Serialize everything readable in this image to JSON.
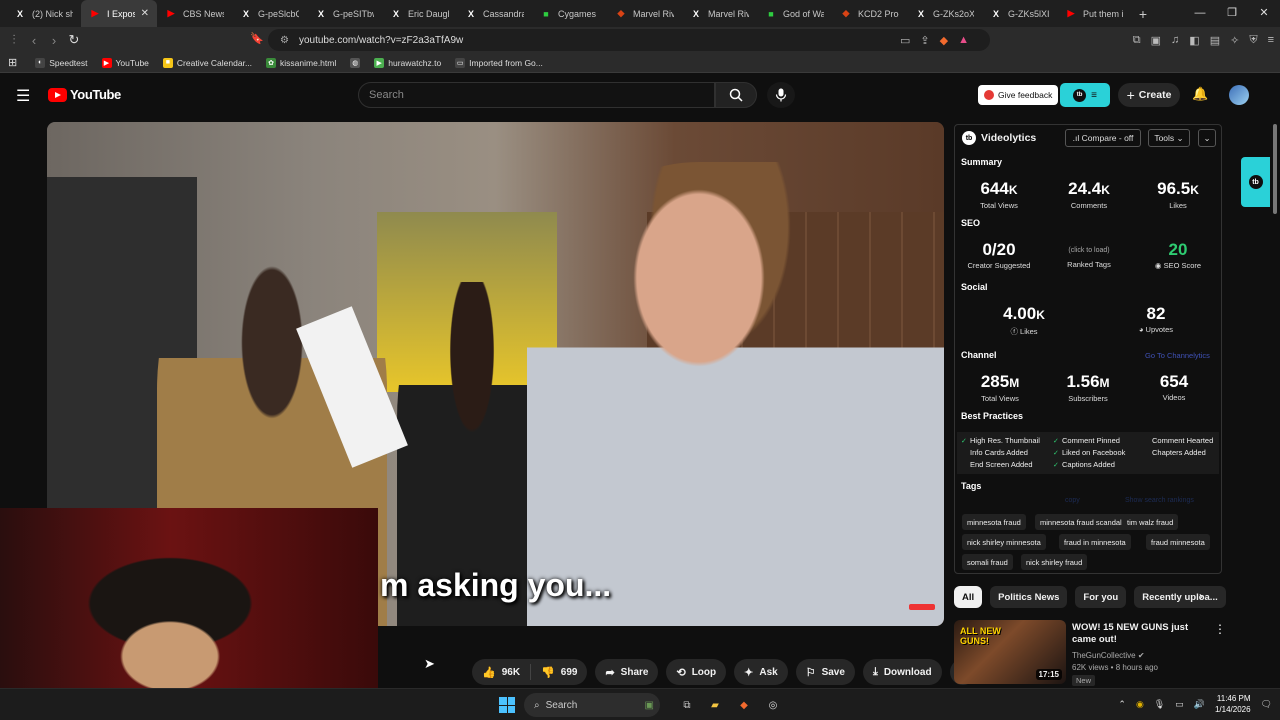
{
  "tabs": [
    {
      "favicon": "X",
      "color": "#000000",
      "title": "(2) Nick sh..."
    },
    {
      "favicon": "▶",
      "color": "#ff0000",
      "title": "I Expos..."
    },
    {
      "favicon": "▶",
      "color": "#ff0000",
      "title": "CBS News o..."
    },
    {
      "favicon": "X",
      "color": "#000000",
      "title": "G-peSlcbQ..."
    },
    {
      "favicon": "X",
      "color": "#000000",
      "title": "G-peSITbw..."
    },
    {
      "favicon": "X",
      "color": "#000000",
      "title": "Eric Daughe..."
    },
    {
      "favicon": "X",
      "color": "#000000",
      "title": "Cassandra ..."
    },
    {
      "favicon": "■",
      "color": "#2ecc40",
      "title": "Cygames La..."
    },
    {
      "favicon": "◆",
      "color": "#d84315",
      "title": "Marvel Riva..."
    },
    {
      "favicon": "X",
      "color": "#000000",
      "title": "Marvel Riva..."
    },
    {
      "favicon": "■",
      "color": "#2ecc40",
      "title": "God of War..."
    },
    {
      "favicon": "◆",
      "color": "#d84315",
      "title": "KCD2 Produ..."
    },
    {
      "favicon": "X",
      "color": "#000000",
      "title": "G-ZKs2oXi..."
    },
    {
      "favicon": "X",
      "color": "#000000",
      "title": "G-ZKs5lXIAl..."
    },
    {
      "favicon": "▶",
      "color": "#ff0000",
      "title": "Put them in..."
    }
  ],
  "browser": {
    "url": "youtube.com/watch?v=zF2a3aTfA9w",
    "new_tab": "+",
    "close_tab": "✕"
  },
  "bookmarks": [
    {
      "label": "Speedtest",
      "icon": "◐",
      "color": "#444"
    },
    {
      "label": "YouTube",
      "icon": "▶",
      "color": "#ff0000"
    },
    {
      "label": "Creative Calendar...",
      "icon": "■",
      "color": "#f5c518"
    },
    {
      "label": "kissanime.html",
      "icon": "✿",
      "color": "#3a8a3a"
    },
    {
      "label": "",
      "icon": "◍",
      "color": "#555"
    },
    {
      "label": "hurawatchz.to",
      "icon": "▶",
      "color": "#4caf50"
    },
    {
      "label": "Imported from Go...",
      "icon": "▭",
      "color": "#444"
    }
  ],
  "youtube": {
    "logo_text": "YouTube",
    "search_placeholder": "Search",
    "feedback_label": "Give feedback",
    "create_label": "Create",
    "caption": "m asking you..."
  },
  "actions": {
    "likes": "96K",
    "dislikes": "699",
    "share": "Share",
    "loop": "Loop",
    "ask": "Ask",
    "save": "Save",
    "download": "Download",
    "more": "⋯"
  },
  "videolytics": {
    "title": "Videolytics",
    "compare": ".ıl Compare - off",
    "tools": "Tools ⌄",
    "summary": {
      "heading": "Summary",
      "views": "644",
      "views_unit": "K",
      "views_label": "Total Views",
      "comments": "24.4",
      "comments_unit": "K",
      "comments_label": "Comments",
      "likes": "96.5",
      "likes_unit": "K",
      "likes_label": "Likes"
    },
    "seo": {
      "heading": "SEO",
      "creator": "0/20",
      "creator_label": "Creator Suggested",
      "ranked_hint": "(click to load)",
      "ranked_label": "Ranked Tags",
      "score": "20",
      "score_label": "SEO Score"
    },
    "social": {
      "heading": "Social",
      "likes": "4.00",
      "likes_unit": "K",
      "likes_label": "Likes",
      "upvotes": "82",
      "upvotes_label": "Upvotes"
    },
    "channel": {
      "heading": "Channel",
      "link": "Go To Channelytics",
      "views": "285",
      "views_unit": "M",
      "views_label": "Total Views",
      "subs": "1.56",
      "subs_unit": "M",
      "subs_label": "Subscribers",
      "videos": "654",
      "videos_label": "Videos"
    },
    "best_practices": {
      "heading": "Best Practices",
      "items": [
        {
          "label": "High Res. Thumbnail",
          "checked": true
        },
        {
          "label": "Comment Pinned",
          "checked": true
        },
        {
          "label": "Comment Hearted",
          "checked": false
        },
        {
          "label": "Info Cards Added",
          "checked": false
        },
        {
          "label": "Liked on Facebook",
          "checked": true
        },
        {
          "label": "Chapters Added",
          "checked": false
        },
        {
          "label": "End Screen Added",
          "checked": false
        },
        {
          "label": "Captions Added",
          "checked": true
        }
      ]
    },
    "tags": {
      "heading": "Tags",
      "copy": "copy",
      "rankings": "Show search rankings",
      "items": [
        "minnesota fraud",
        "minnesota fraud scandal",
        "tim walz fraud",
        "nick shirley minnesota",
        "fraud in minnesota",
        "fraud minnesota",
        "somali fraud",
        "nick shirley fraud"
      ]
    }
  },
  "chips": [
    "All",
    "Politics News",
    "For you",
    "Recently uploa..."
  ],
  "recommended": {
    "thumb_text_1": "ALL NEW",
    "thumb_text_2": "GUNS!",
    "duration": "17:15",
    "title": "WOW! 15 NEW GUNS just came out!",
    "channel": "TheGunCollective",
    "meta": "62K views • 8 hours ago",
    "badge": "New"
  },
  "taskbar": {
    "search": "Search",
    "time": "11:46 PM",
    "date": "1/14/2026"
  }
}
